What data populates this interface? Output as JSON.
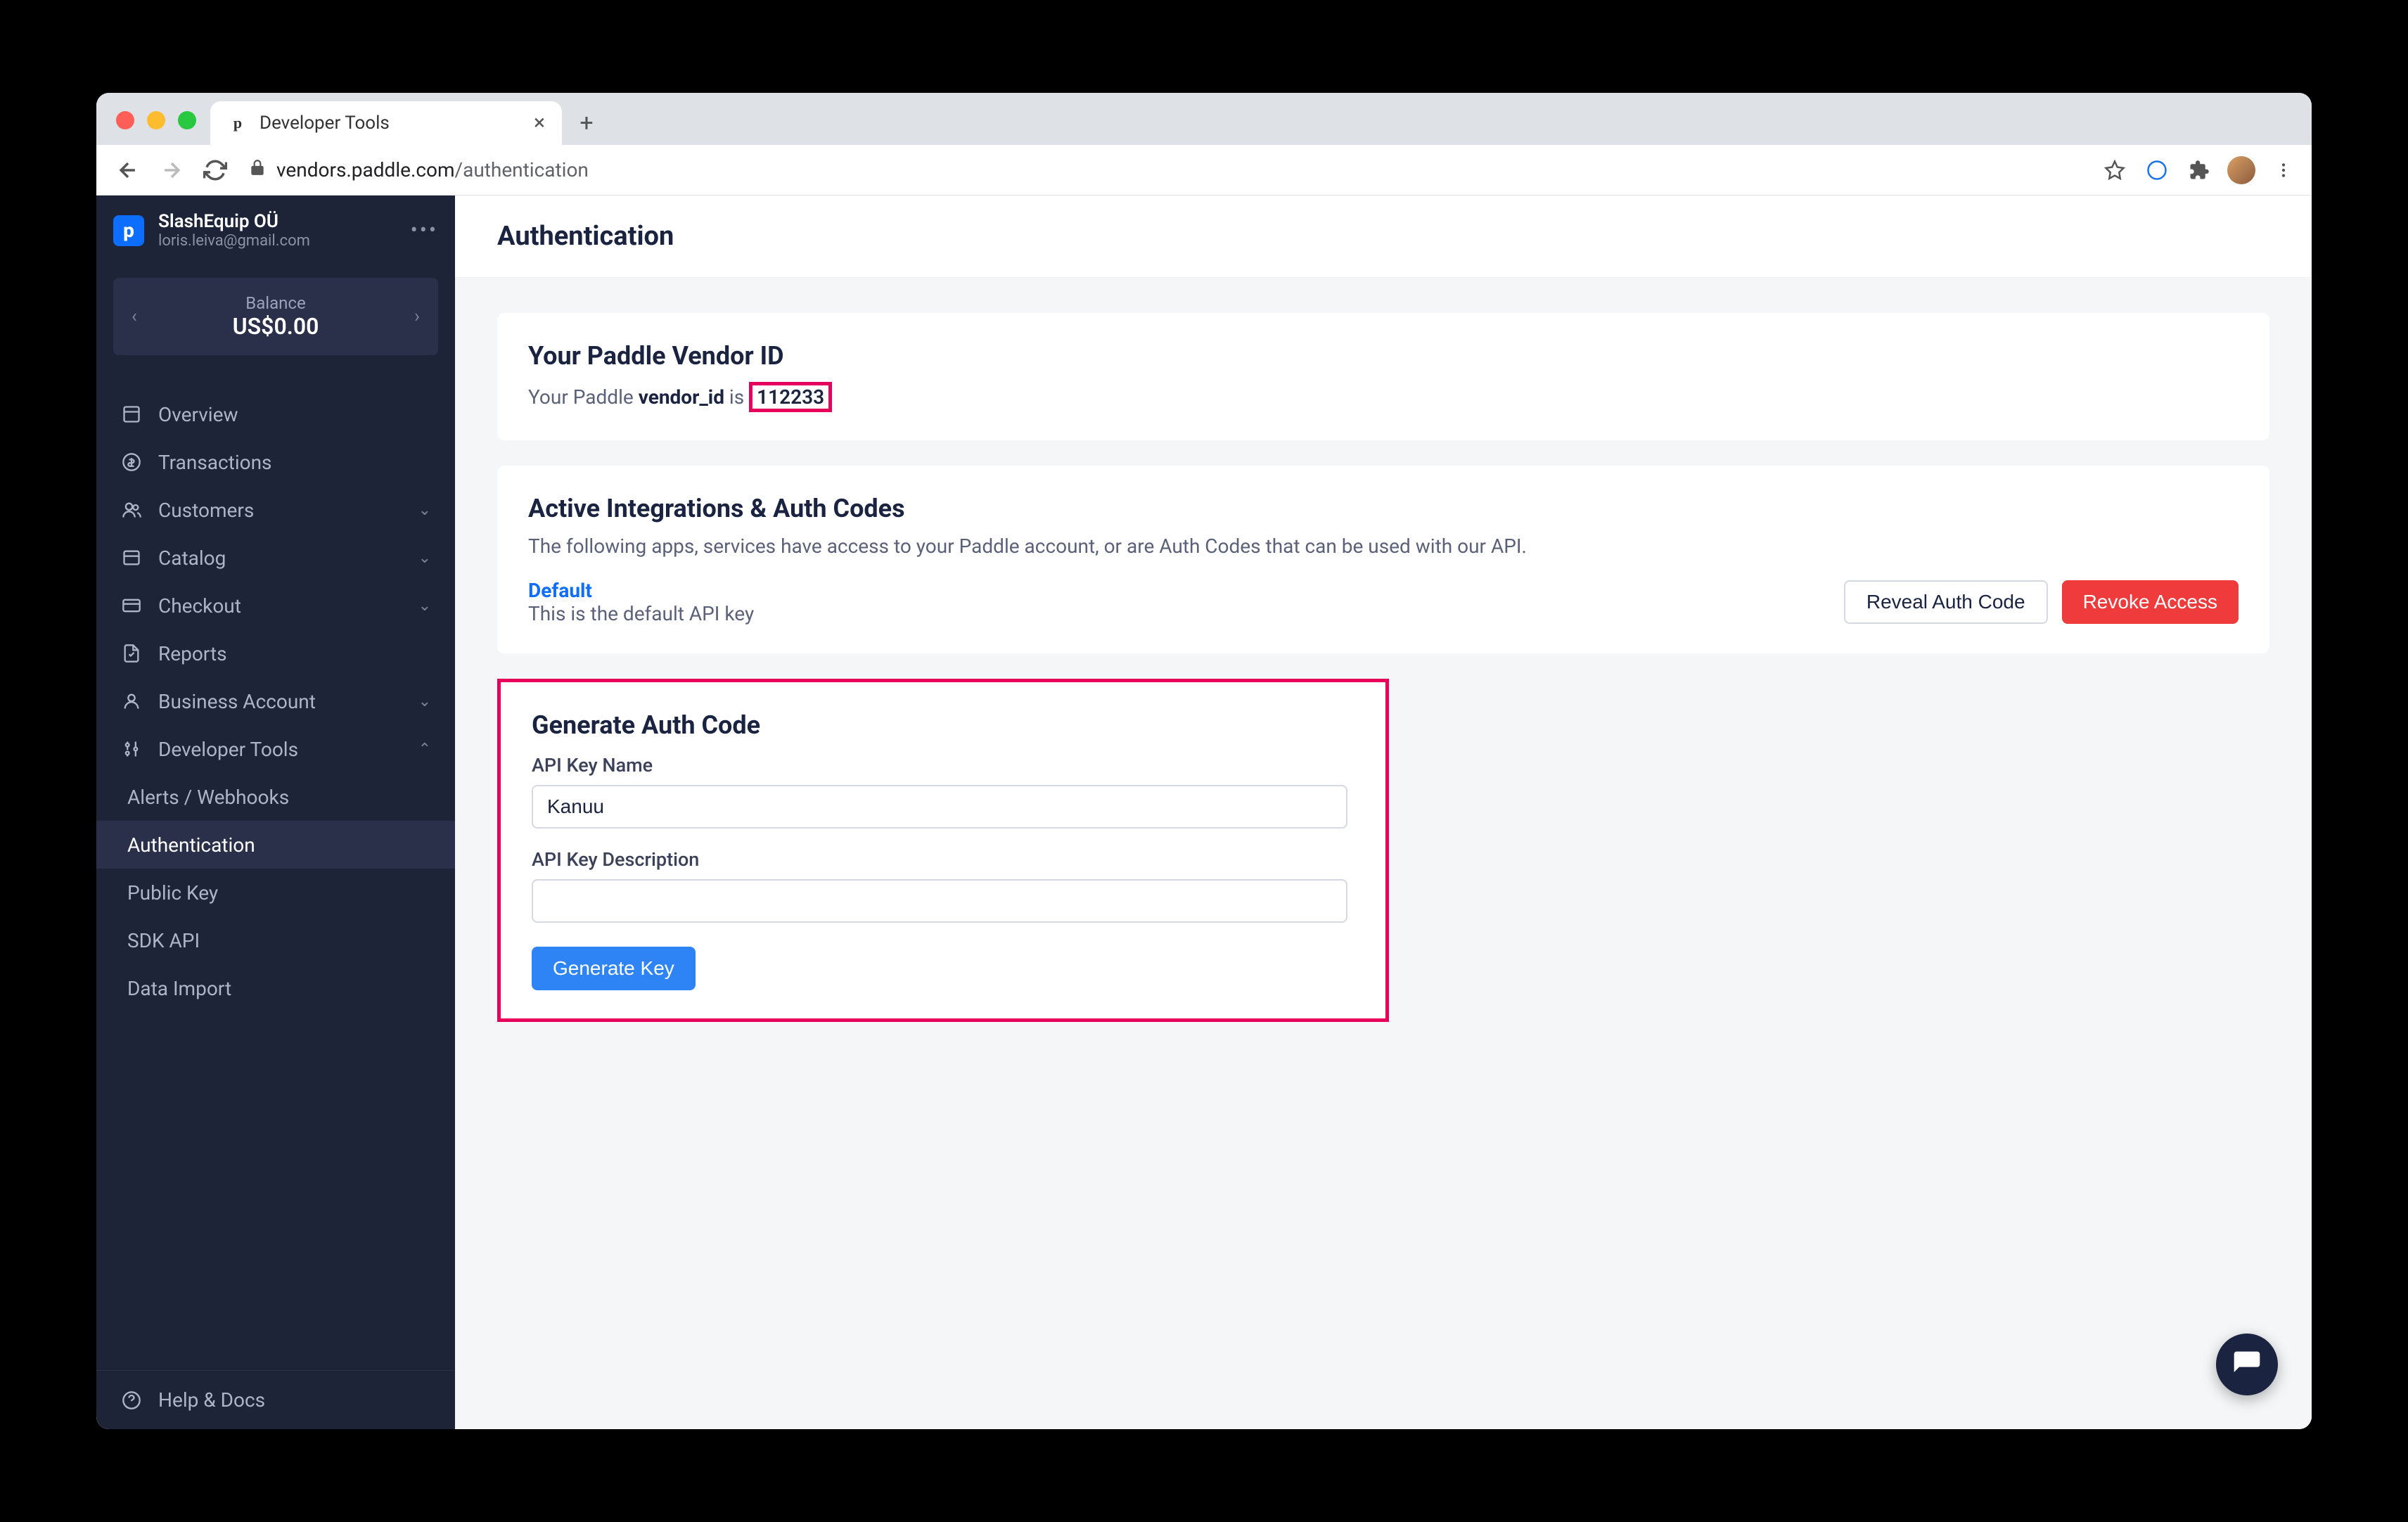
{
  "browser": {
    "tab_title": "Developer Tools",
    "url_host": "vendors.paddle.com",
    "url_path": "/authentication"
  },
  "sidebar": {
    "org_name": "SlashEquip OÜ",
    "org_email": "loris.leiva@gmail.com",
    "balance_label": "Balance",
    "balance_amount": "US$0.00",
    "items": [
      {
        "label": "Overview"
      },
      {
        "label": "Transactions"
      },
      {
        "label": "Customers"
      },
      {
        "label": "Catalog"
      },
      {
        "label": "Checkout"
      },
      {
        "label": "Reports"
      },
      {
        "label": "Business Account"
      },
      {
        "label": "Developer Tools"
      }
    ],
    "dev_subitems": [
      {
        "label": "Alerts / Webhooks"
      },
      {
        "label": "Authentication"
      },
      {
        "label": "Public Key"
      },
      {
        "label": "SDK API"
      },
      {
        "label": "Data Import"
      }
    ],
    "footer": "Help  &  Docs"
  },
  "page": {
    "title": "Authentication",
    "vendor_card": {
      "title": "Your Paddle Vendor ID",
      "line_prefix": "Your Paddle ",
      "line_bold": "vendor_id",
      "line_is": " is ",
      "id_value": "112233"
    },
    "integrations_card": {
      "title": "Active Integrations & Auth Codes",
      "subtitle": "The following apps, services have access to your Paddle account, or are Auth Codes that can be used with our API.",
      "item_name": "Default",
      "item_desc": "This is the default API key",
      "reveal_btn": "Reveal Auth Code",
      "revoke_btn": "Revoke Access"
    },
    "generate_card": {
      "title": "Generate Auth Code",
      "name_label": "API Key Name",
      "name_value": "Kanuu",
      "desc_label": "API Key Description",
      "desc_value": "",
      "submit_btn": "Generate Key"
    }
  }
}
